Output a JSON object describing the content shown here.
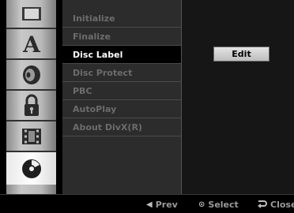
{
  "menu": {
    "items": [
      {
        "label": "Initialize",
        "state": "disabled"
      },
      {
        "label": "Finalize",
        "state": "disabled"
      },
      {
        "label": "Disc Label",
        "state": "active"
      },
      {
        "label": "Disc Protect",
        "state": "disabled"
      },
      {
        "label": "PBC",
        "state": "disabled"
      },
      {
        "label": "AutoPlay",
        "state": "disabled"
      },
      {
        "label": "About DivX(R)",
        "state": "disabled"
      }
    ]
  },
  "panel": {
    "edit_label": "Edit"
  },
  "sidebar": {
    "icons": [
      {
        "name": "display-icon",
        "selected": false
      },
      {
        "name": "language-icon",
        "selected": false
      },
      {
        "name": "audio-icon",
        "selected": false
      },
      {
        "name": "lock-icon",
        "selected": false
      },
      {
        "name": "recording-icon",
        "selected": false
      },
      {
        "name": "disc-icon",
        "selected": true
      }
    ]
  },
  "hints": {
    "prev": {
      "icon": "◀",
      "label": "Prev"
    },
    "select": {
      "icon": "⊙",
      "label": "Select"
    },
    "close": {
      "icon": "return-icon",
      "label": "Close"
    }
  },
  "colors": {
    "active_text": "#ffffff",
    "disabled_text": "#6c6c6c",
    "menu_bg": "#2c2c2c"
  }
}
